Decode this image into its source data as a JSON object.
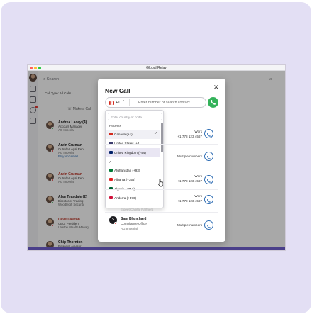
{
  "window": {
    "title": "Global Relay"
  },
  "app_bg": {
    "search_label": "Search",
    "call_type": "Call Type: All Calls",
    "make_call": "Make a Call",
    "top_right": "M"
  },
  "contacts": [
    {
      "name": "Andrea Lacey (4)",
      "line1": "Account Manager",
      "line2": "AG Imperial",
      "line3": "",
      "presence": "#2fa84f"
    },
    {
      "name": "Arvin Guzman",
      "line1": "Outside Legal Rep",
      "line2": "AG Imperial",
      "line3": "Play Voicemail",
      "presence": "#e53935"
    },
    {
      "name": "Arvin Guzman",
      "line1": "Outside Legal Rep",
      "line2": "AG Imperial",
      "line3": "",
      "presence": "#e53935"
    },
    {
      "name": "Alan Teasdale (2)",
      "line1": "Director of Trading",
      "line2": "Woodleigh Security",
      "line3": "",
      "presence": "#2fa84f"
    },
    {
      "name": "Dave Lawton",
      "line1": "CEO, President",
      "line2": "Lawton Wealth Manag",
      "line3": "",
      "presence": "#e53935"
    },
    {
      "name": "Chip Thornton",
      "line1": "Financial Advisor",
      "line2": "",
      "line3": "",
      "presence": "#2fa84f"
    }
  ],
  "modal": {
    "title": "New Call",
    "close_glyph": "✕",
    "country_code": "+1",
    "country_chevron": "^",
    "phone_placeholder": "Enter number or search contact",
    "country_search_placeholder": "Enter country or code",
    "sections": {
      "recents": "Recents",
      "a": "A"
    },
    "recents": [
      {
        "label": "Canada (+1)",
        "flag": "#d52b1e",
        "selected": true
      },
      {
        "label": "United States (+1)",
        "flag": "#3c3b6e",
        "selected": false
      },
      {
        "label": "United Kingdom (+44)",
        "flag": "#012169",
        "selected": false
      }
    ],
    "a_countries": [
      {
        "label": "Afghanistan (+93)",
        "flag": "#007a36"
      },
      {
        "label": "Albania (+355)",
        "flag": "#e41e20"
      },
      {
        "label": "Algeria (+213)",
        "flag": "#006233"
      },
      {
        "label": "Andorra (+376)",
        "flag": "#d0103a"
      }
    ],
    "check_glyph": "✓",
    "results": [
      {
        "label_top": "Work",
        "label_bottom": "+1 778 123 4567"
      },
      {
        "label_top": "Multiple numbers",
        "label_bottom": ""
      },
      {
        "label_top": "Work",
        "label_bottom": "+1 778 123 4567"
      },
      {
        "label_top": "Work",
        "label_bottom": "+1 778 123 4567"
      },
      {
        "label_top": "Multiple numbers",
        "label_bottom": ""
      }
    ],
    "peek_text": "Elgeet Capital Partners",
    "sam": {
      "initials": "S",
      "name": "Sam Blanchard",
      "role": "Compliance Officer",
      "company": "AG Imperial"
    }
  },
  "colors": {
    "accent": "#2e6db4",
    "call_green": "#34b25a",
    "alert_red": "#e53935",
    "background_card": "#e3dff4"
  }
}
